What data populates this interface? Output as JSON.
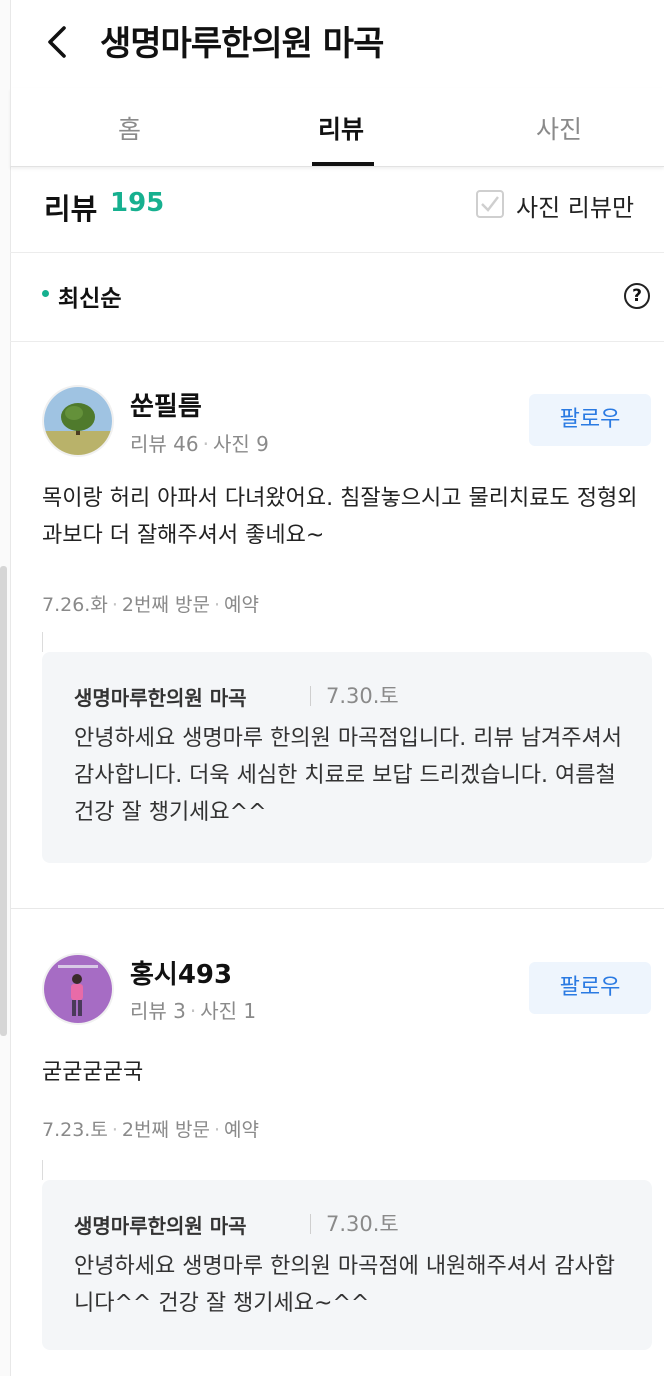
{
  "header": {
    "title": "생명마루한의원 마곡",
    "back_icon": "chevron-left-icon"
  },
  "tabs": [
    {
      "label": "홈"
    },
    {
      "label": "리뷰",
      "active": true
    },
    {
      "label": "사진"
    }
  ],
  "review_summary": {
    "title": "리뷰",
    "count": "195",
    "photo_only_label": "사진 리뷰만",
    "photo_only_checked": false
  },
  "sort": {
    "label": "최신순",
    "help_icon": "?"
  },
  "colors": {
    "accent": "#16b08f",
    "follow_text": "#2a7ae2",
    "follow_bg": "#eef5fd",
    "reply_bg": "#f4f6f8"
  },
  "reviews": [
    {
      "user": "쑨필름",
      "review_count": "리뷰 46",
      "photo_count": "사진 9",
      "follow_label": "팔로우",
      "text": "목이랑 허리 아파서 다녀왔어요. 침잘놓으시고 물리치료도 정형외과보다 더 잘해주셔서 좋네요~",
      "date": "7.26.화",
      "visit": "2번째 방문",
      "type": "예약",
      "reply": {
        "name": "생명마루한의원 마곡",
        "date": "7.30.토",
        "text": "안녕하세요 생명마루 한의원 마곡점입니다. 리뷰 남겨주셔서 감사합니다. 더욱 세심한 치료로 보답 드리겠습니다. 여름철 건강 잘 챙기세요^^"
      }
    },
    {
      "user": "홍시493",
      "review_count": "리뷰 3",
      "photo_count": "사진 1",
      "follow_label": "팔로우",
      "text": "굳굳굳굳국",
      "date": "7.23.토",
      "visit": "2번째 방문",
      "type": "예약",
      "reply": {
        "name": "생명마루한의원 마곡",
        "date": "7.30.토",
        "text": "안녕하세요 생명마루 한의원 마곡점에 내원해주셔서 감사합니다^^ 건강 잘 챙기세요~^^"
      }
    }
  ]
}
